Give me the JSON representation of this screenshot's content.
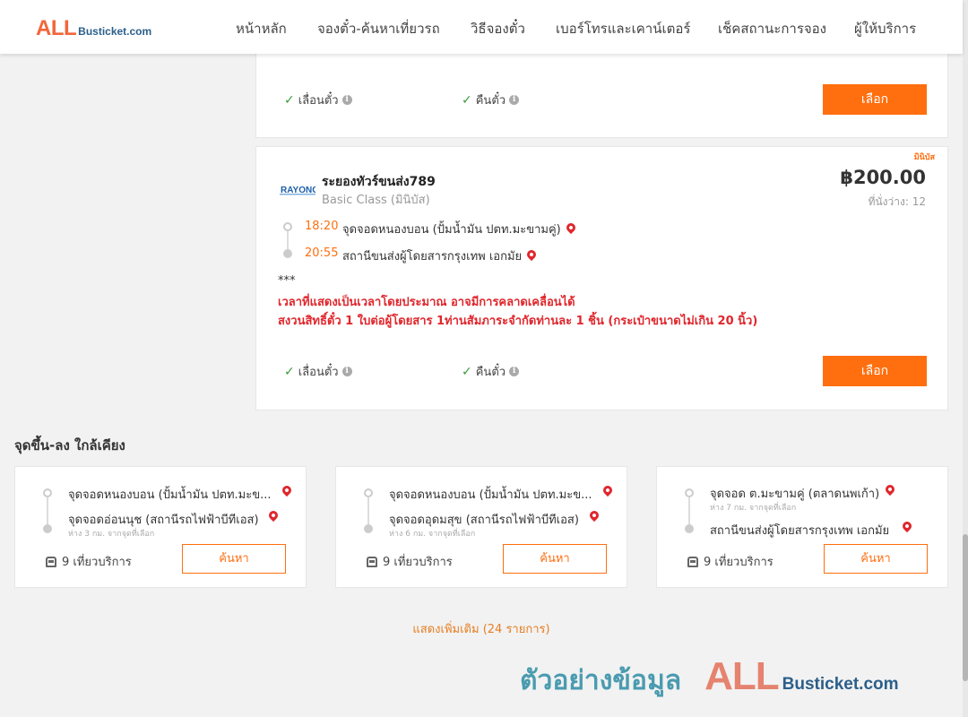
{
  "header": {
    "logo_all": "ALL",
    "logo_rest": "Busticket.com",
    "nav": [
      "หน้าหลัก",
      "จองตั๋ว-ค้นหาเที่ยวรถ",
      "วิธีจองตั๋ว",
      "เบอร์โทรและเคาน์เตอร์",
      "เช็คสถานะการจอง",
      "ผู้ให้บริการ"
    ]
  },
  "card_top": {
    "feature_1": "เลื่อนตั๋ว",
    "feature_2": "คืนตั๋ว",
    "select_label": "เลือก"
  },
  "trip": {
    "badge": "มินิบัส",
    "operator_logo": "RAYONG",
    "operator_name": "ระยองทัวร์ขนส่ง789",
    "bus_class": "Basic Class (มินิบัส)",
    "price": "฿200.00",
    "seats": "ที่นั่งว่าง: 12",
    "depart_time": "18:20",
    "depart_stop": "จุดจอดหนองบอน (ปั้มน้ำมัน ปตท.มะขามคู่)",
    "arrive_time": "20:55",
    "arrive_stop": "สถานีขนส่งผู้โดยสารกรุงเทพ เอกมัย",
    "note_stars": "***",
    "note_line_1": "เวลาที่แสดงเป็นเวลาโดยประมาณ อาจมีการคลาดเคลื่อนได้",
    "note_line_2": "สงวนสิทธิ์ตั๋ว 1 ใบต่อผู้โดยสาร 1ท่านสัมภาระจำกัดท่านละ 1 ชิ้น (กระเป๋าขนาดไม่เกิน 20 นิ้ว)",
    "feature_1": "เลื่อนตั๋ว",
    "feature_2": "คืนตั๋ว",
    "select_label": "เลือก"
  },
  "nearby": {
    "title": "จุดขึ้น-ลง ใกล้เคียง",
    "cards": [
      {
        "from": "จุดจอดหนองบอน (ปั้มน้ำมัน ปตท.มะข...",
        "from_sub": "",
        "to": "จุดจอดอ่อนนุช (สถานีรถไฟฟ้าบีทีเอส)",
        "to_sub": "ห่าง 3 กม. จากจุดที่เลือก",
        "trips": "9 เที่ยวบริการ",
        "search_label": "ค้นหา"
      },
      {
        "from": "จุดจอดหนองบอน (ปั้มน้ำมัน ปตท.มะข...",
        "from_sub": "",
        "to": "จุดจอดอุดมสุข (สถานีรถไฟฟ้าบีทีเอส)",
        "to_sub": "ห่าง 6 กม. จากจุดที่เลือก",
        "trips": "9 เที่ยวบริการ",
        "search_label": "ค้นหา"
      },
      {
        "from": "จุดจอด ต.มะขามคู่ (ตลาดนพเก้า)",
        "from_sub": "ห่าง 7 กม. จากจุดที่เลือก",
        "to": "สถานีขนส่งผู้โดยสารกรุงเทพ เอกมัย",
        "to_sub": "",
        "trips": "9 เที่ยวบริการ",
        "search_label": "ค้นหา"
      }
    ],
    "more_label": "แสดงเพิ่มเติม (24 รายการ)"
  },
  "watermark": {
    "thai": "ตัวอย่างข้อมูล",
    "all": "ALL",
    "rest": "Busticket.com"
  },
  "colors": {
    "accent": "#ff6f0f",
    "alert": "#e0262c",
    "check": "#3c9b3c"
  }
}
